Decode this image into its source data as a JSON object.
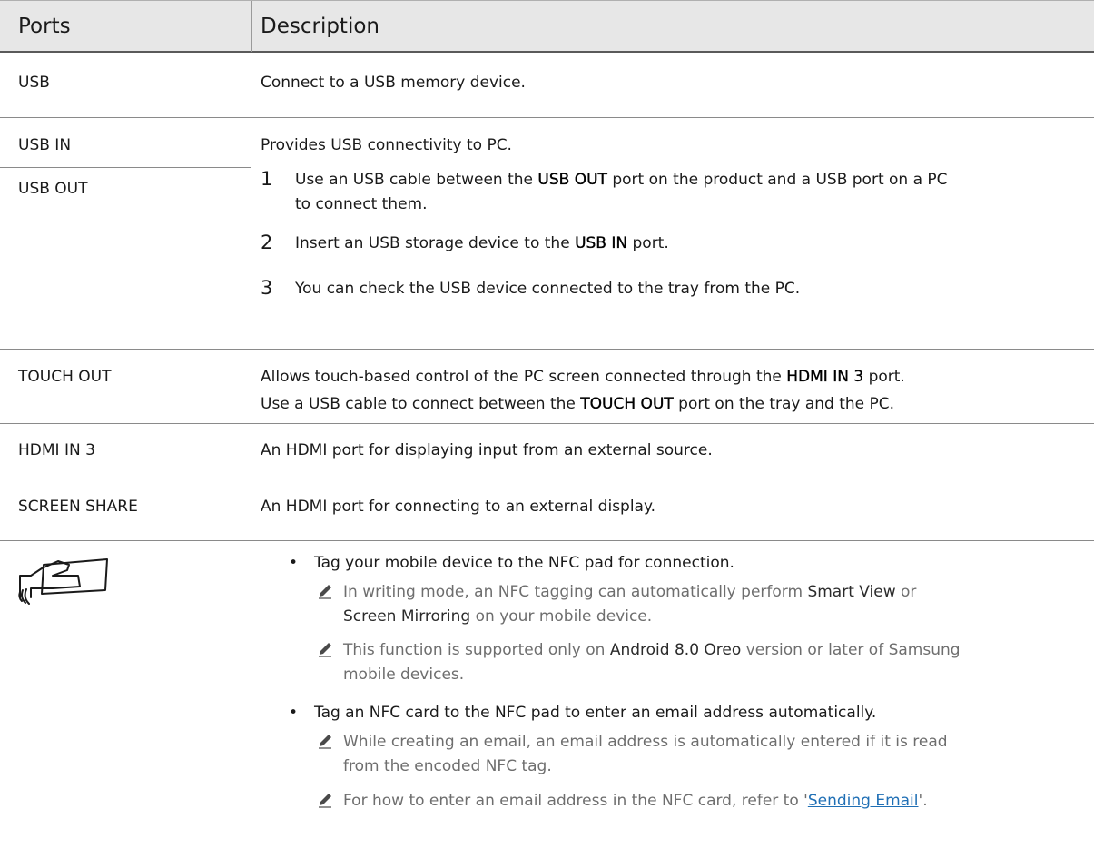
{
  "header": {
    "col_ports": "Ports",
    "col_description": "Description"
  },
  "rows": {
    "usb": {
      "port": "USB",
      "desc": "Connect to a USB memory device."
    },
    "usb_in_out": {
      "port_in": "USB IN",
      "port_out": "USB OUT",
      "intro": "Provides USB connectivity to PC.",
      "steps": [
        {
          "num": "1",
          "pre": "Use an USB cable between the ",
          "bold": "USB OUT",
          "post": " port on the product and a USB port on a PC",
          "line2": "to connect them."
        },
        {
          "num": "2",
          "pre": "Insert an USB storage device to the ",
          "bold": "USB IN",
          "post": " port."
        },
        {
          "num": "3",
          "text": "You can check the USB device connected to the tray from the PC."
        }
      ]
    },
    "touch_out": {
      "port": "TOUCH OUT",
      "line1_pre": "Allows touch-based control of the PC screen connected through the ",
      "line1_bold": "HDMI IN 3",
      "line1_post": " port.",
      "line2_pre": "Use a USB cable to connect between the ",
      "line2_bold": "TOUCH OUT",
      "line2_post": " port on the tray and the PC."
    },
    "hdmi_in_3": {
      "port": "HDMI IN 3",
      "desc": "An HDMI port for displaying input from an external source."
    },
    "screen_share": {
      "port": "SCREEN SHARE",
      "desc": "An HDMI port for connecting to an external display."
    },
    "nfc": {
      "icon": "nfc-tag-icon",
      "bullet1": "Tag your mobile device to the NFC pad for connection.",
      "note1_pre": "In writing mode, an NFC tagging can automatically perform ",
      "note1_bold1": "Smart View",
      "note1_mid": " or",
      "note1_bold2": "Screen Mirroring",
      "note1_post": " on your mobile device.",
      "note2_pre": "This function is supported only on ",
      "note2_bold": "Android 8.0 Oreo",
      "note2_post": " version or later of Samsung",
      "note2_line2": "mobile devices.",
      "bullet2": "Tag an NFC card to the NFC pad to enter an email address automatically.",
      "note3_line1": "While creating an email, an email address is automatically entered if it is read",
      "note3_line2": "from the encoded NFC tag.",
      "note4_pre": "For how to enter an email address in the NFC card, refer to '",
      "note4_link": "Sending Email",
      "note4_post": "'."
    }
  },
  "colors": {
    "header_bg": "#e7e7e7",
    "rule": "#8a8a8a",
    "note_text": "#6e6e6e",
    "link": "#1f6fb5"
  }
}
